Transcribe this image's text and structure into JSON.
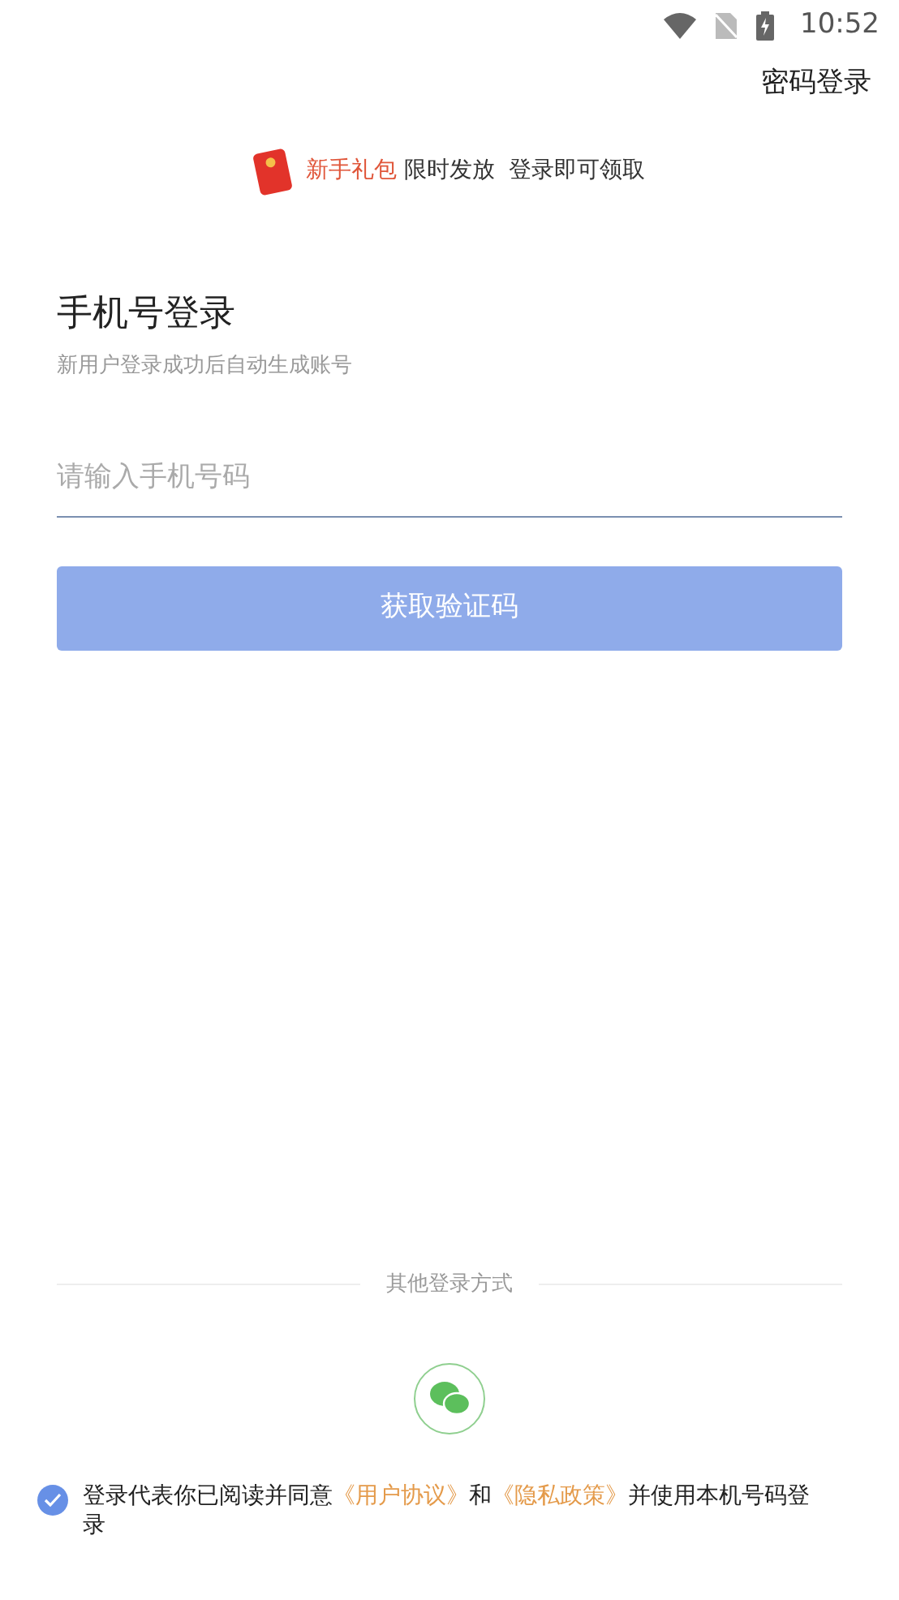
{
  "status_bar": {
    "time": "10:52"
  },
  "top_link": "密码登录",
  "promo": {
    "highlight": "新手礼包",
    "text": "限时发放  登录即可领取"
  },
  "title": "手机号登录",
  "subtitle": "新用户登录成功后自动生成账号",
  "phone_field": {
    "placeholder": "请输入手机号码"
  },
  "code_button": {
    "label": "获取验证码",
    "disabled": true
  },
  "other_login": {
    "label": "其他登录方式"
  },
  "agreement": {
    "checked": true,
    "parts": [
      {
        "kind": "text",
        "text": "登录代表你已阅读并同意"
      },
      {
        "kind": "link",
        "text": "《用户协议》"
      },
      {
        "kind": "text",
        "text": "和"
      },
      {
        "kind": "link",
        "text": "《隐私政策》"
      },
      {
        "kind": "text",
        "text": "并使用本机号码登录"
      }
    ]
  }
}
